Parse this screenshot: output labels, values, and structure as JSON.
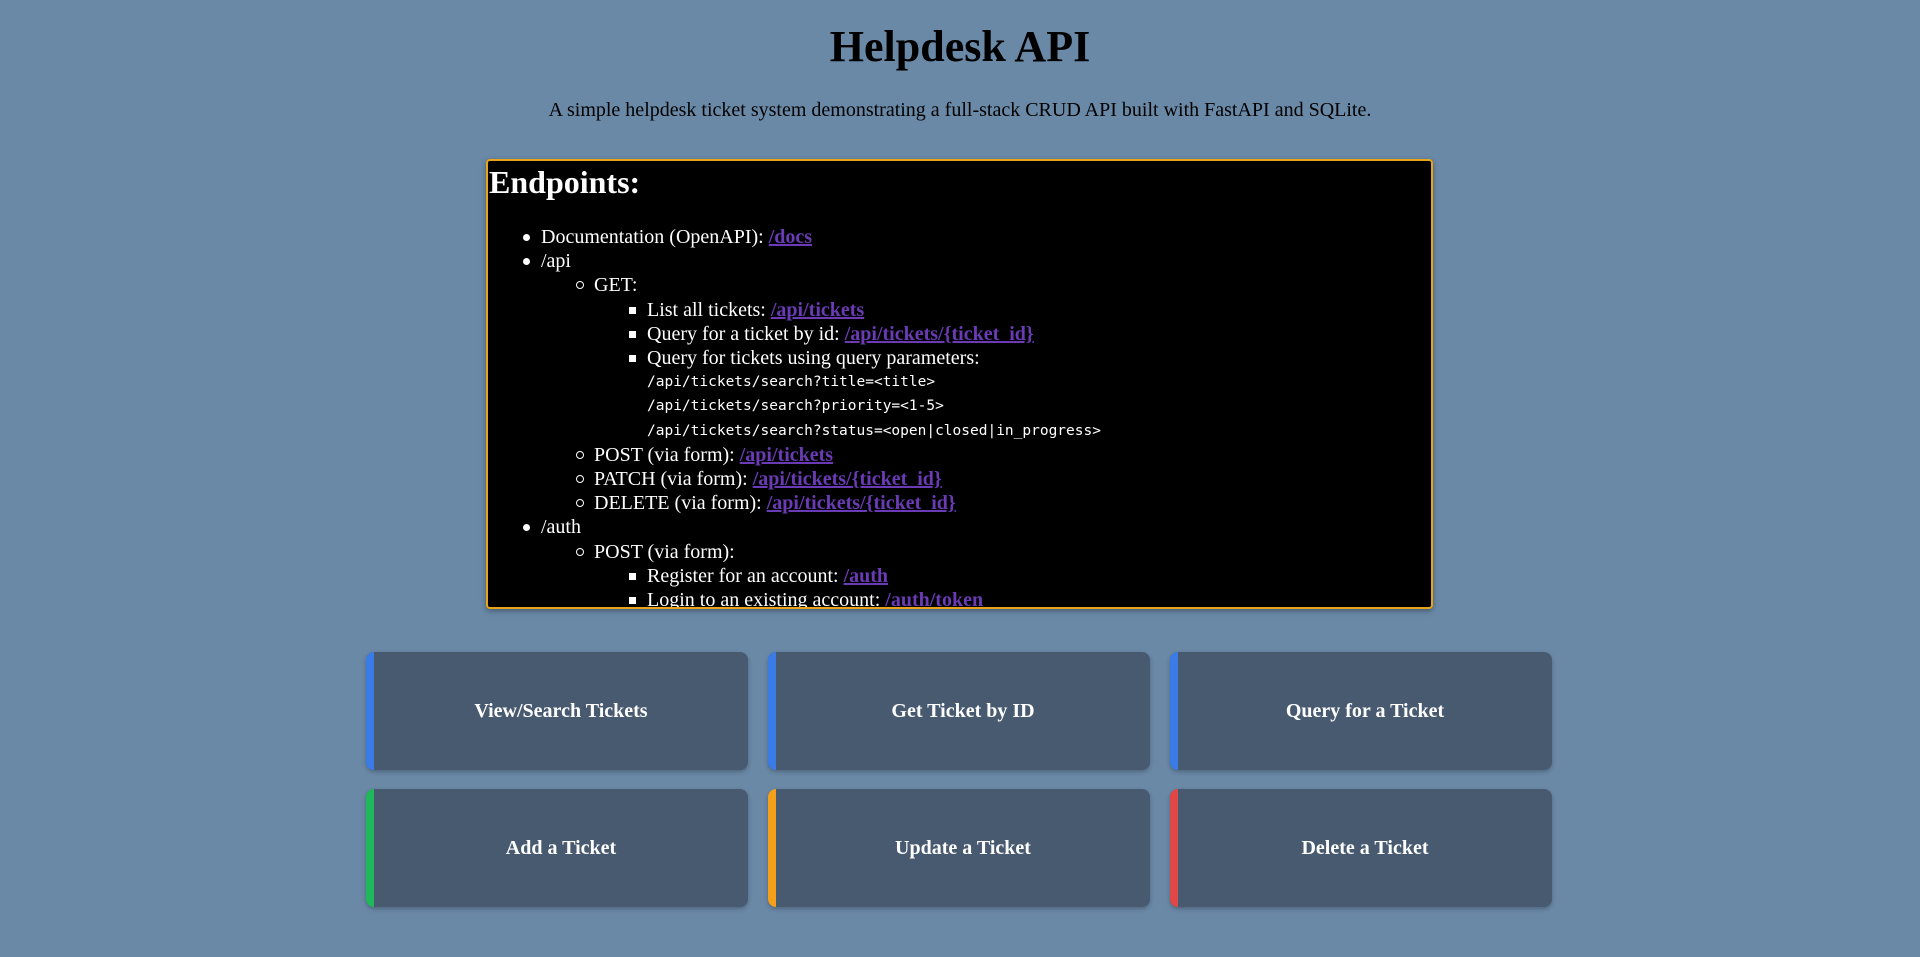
{
  "header": {
    "title": "Helpdesk API",
    "subtitle": "A simple helpdesk ticket system demonstrating a full-stack CRUD API built with FastAPI and SQLite."
  },
  "endpoints": {
    "heading": "Endpoints:",
    "docs_label": "Documentation (OpenAPI):",
    "docs_link": "/docs",
    "api_label": "/api",
    "get_label": "GET:",
    "list_all_label": "List all tickets:",
    "list_all_link": "/api/tickets",
    "by_id_label": "Query for a ticket by id:",
    "by_id_link": "/api/tickets/{ticket_id}",
    "query_params_label": "Query for tickets using query parameters:",
    "query_title": "/api/tickets/search?title=<title>",
    "query_priority": "/api/tickets/search?priority=<1-5>",
    "query_status": "/api/tickets/search?status=<open|closed|in_progress>",
    "post_label": "POST (via form):",
    "post_link": "/api/tickets",
    "patch_label": "PATCH (via form):",
    "patch_link": "/api/tickets/{ticket_id}",
    "delete_label": "DELETE (via form):",
    "delete_link": "/api/tickets/{ticket_id}",
    "auth_label": "/auth",
    "auth_post_label": "POST (via form):",
    "register_label": "Register for an account:",
    "register_link": "/auth",
    "login_label": "Login to an existing account:",
    "login_link": "/auth/token"
  },
  "actions": [
    {
      "label": "View/Search Tickets",
      "accent": "#3b7be8"
    },
    {
      "label": "Get Ticket by ID",
      "accent": "#3b7be8"
    },
    {
      "label": "Query for a Ticket",
      "accent": "#3b7be8"
    },
    {
      "label": "Add a Ticket",
      "accent": "#1fb85a"
    },
    {
      "label": "Update a Ticket",
      "accent": "#f5a01a"
    },
    {
      "label": "Delete a Ticket",
      "accent": "#e04848"
    }
  ]
}
